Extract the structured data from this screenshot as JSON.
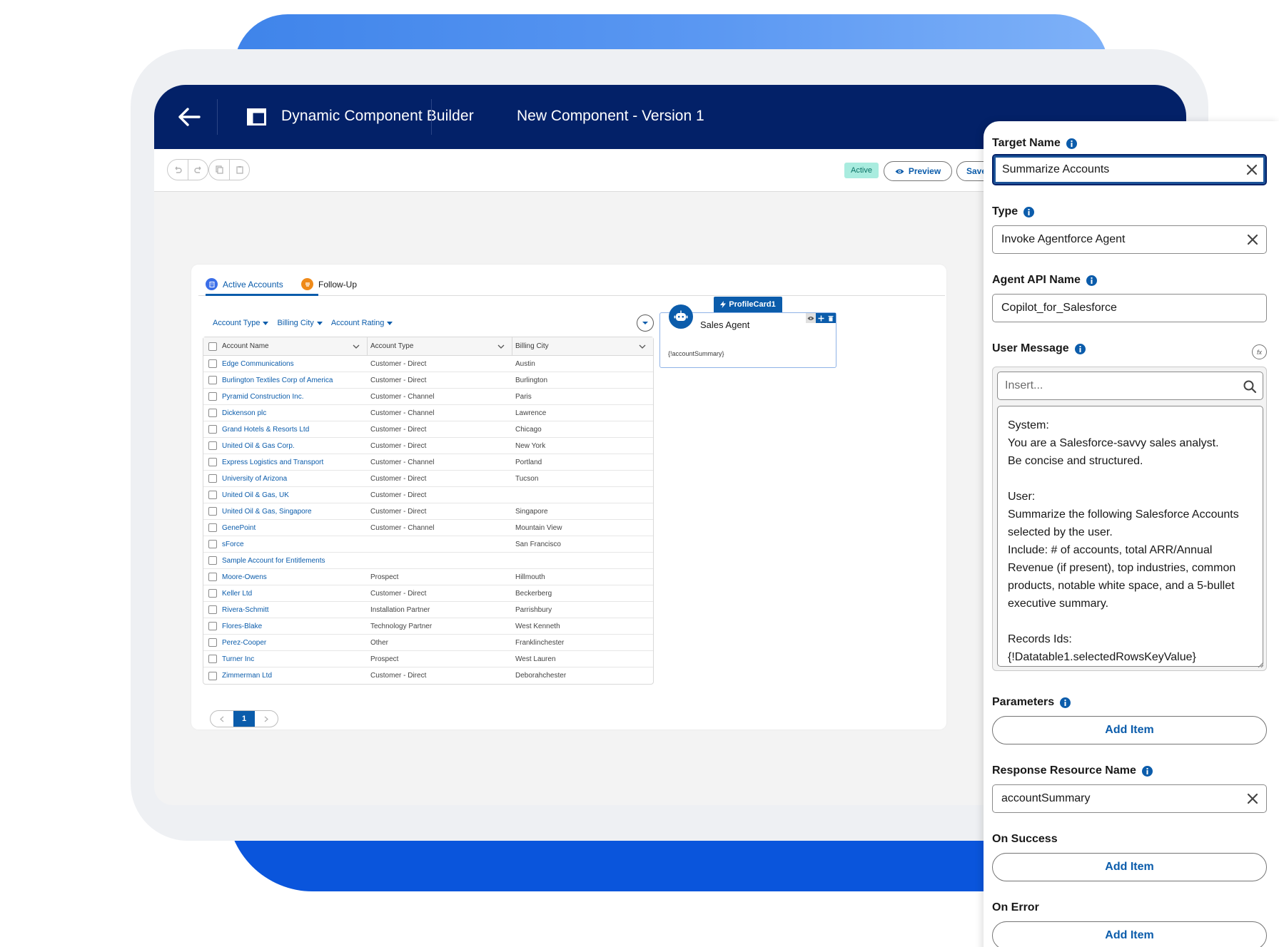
{
  "header": {
    "app_title": "Dynamic Component Builder",
    "component_title": "New Component - Version 1"
  },
  "toolbar": {
    "status_badge": "Active",
    "preview_label": "Preview",
    "save_label": "Save"
  },
  "canvas": {
    "tabs": [
      {
        "label": "Active Accounts",
        "icon": "account-icon"
      },
      {
        "label": "Follow-Up",
        "icon": "list-icon"
      }
    ],
    "filters": [
      "Account Type",
      "Billing City",
      "Account Rating"
    ],
    "table": {
      "columns": [
        "Account Name",
        "Account Type",
        "Billing City"
      ],
      "rows": [
        [
          "Edge Communications",
          "Customer - Direct",
          "Austin"
        ],
        [
          "Burlington Textiles Corp of America",
          "Customer - Direct",
          "Burlington"
        ],
        [
          "Pyramid Construction Inc.",
          "Customer - Channel",
          "Paris"
        ],
        [
          "Dickenson plc",
          "Customer - Channel",
          "Lawrence"
        ],
        [
          "Grand Hotels & Resorts Ltd",
          "Customer - Direct",
          "Chicago"
        ],
        [
          "United Oil & Gas Corp.",
          "Customer - Direct",
          "New York"
        ],
        [
          "Express Logistics and Transport",
          "Customer - Channel",
          "Portland"
        ],
        [
          "University of Arizona",
          "Customer - Direct",
          "Tucson"
        ],
        [
          "United Oil & Gas, UK",
          "Customer - Direct",
          ""
        ],
        [
          "United Oil & Gas, Singapore",
          "Customer - Direct",
          "Singapore"
        ],
        [
          "GenePoint",
          "Customer - Channel",
          "Mountain View"
        ],
        [
          "sForce",
          "",
          "San Francisco"
        ],
        [
          "Sample Account for Entitlements",
          "",
          ""
        ],
        [
          "Moore-Owens",
          "Prospect",
          "Hillmouth"
        ],
        [
          "Keller Ltd",
          "Customer - Direct",
          "Beckerberg"
        ],
        [
          "Rivera-Schmitt",
          "Installation Partner",
          "Parrishbury"
        ],
        [
          "Flores-Blake",
          "Technology Partner",
          "West Kenneth"
        ],
        [
          "Perez-Cooper",
          "Other",
          "Franklinchester"
        ],
        [
          "Turner Inc",
          "Prospect",
          "West Lauren"
        ],
        [
          "Zimmerman Ltd",
          "Customer - Direct",
          "Deborahchester"
        ]
      ]
    },
    "pagination": {
      "current_page": "1"
    },
    "profile_card": {
      "tag_label": "ProfileCard1",
      "title": "Sales Agent",
      "body": "{!accountSummary}"
    }
  },
  "panel": {
    "target_name_label": "Target Name",
    "target_name_value": "Summarize Accounts",
    "type_label": "Type",
    "type_value": "Invoke Agentforce Agent",
    "agent_api_label": "Agent API Name",
    "agent_api_value": "Copilot_for_Salesforce",
    "user_message_label": "User Message",
    "fx_label": "fx",
    "insert_placeholder": "Insert...",
    "user_message_value": "System:\nYou are a Salesforce-savvy sales analyst.\nBe concise and structured.\n\nUser:\nSummarize the following Salesforce Accounts selected by the user.\nInclude: # of accounts, total ARR/Annual Revenue (if present), top industries, common products, notable white space, and a 5-bullet executive summary.\n\nRecords Ids:\n{!Datatable1.selectedRowsKeyValue}",
    "parameters_label": "Parameters",
    "response_label": "Response Resource Name",
    "response_value": "accountSummary",
    "on_success_label": "On Success",
    "on_error_label": "On Error",
    "add_item_label": "Add Item"
  }
}
